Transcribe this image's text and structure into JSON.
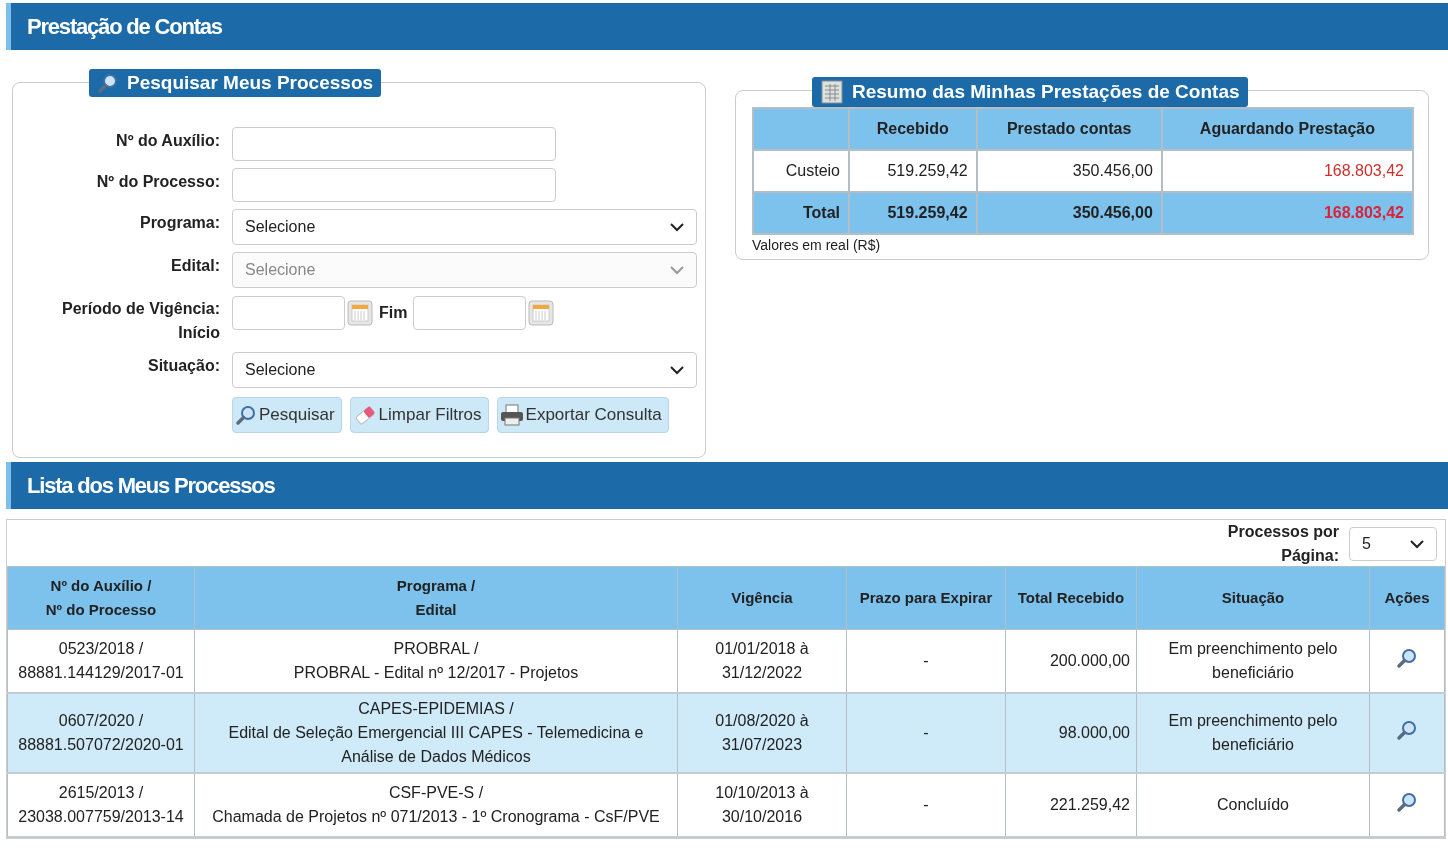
{
  "header": {
    "title": "Prestação de Contas"
  },
  "search": {
    "legend": "Pesquisar Meus Processos",
    "fields": [
      {
        "kind": "text",
        "label": "Nº do Auxílio:"
      },
      {
        "kind": "text",
        "label": "Nº do Processo:"
      },
      {
        "kind": "select",
        "label": "Programa:",
        "value": "Selecione",
        "disabled": false
      },
      {
        "kind": "select",
        "label": "Edital:",
        "value": "Selecione",
        "disabled": true
      },
      {
        "kind": "daterange",
        "label": "Período de Vigência:\nInício",
        "end_label": "Fim"
      },
      {
        "kind": "select",
        "label": "Situação:",
        "value": "Selecione",
        "disabled": false
      }
    ],
    "buttons": [
      {
        "kind": "search",
        "label": "Pesquisar"
      },
      {
        "kind": "eraser",
        "label": "Limpar Filtros"
      },
      {
        "kind": "printer",
        "label": "Exportar Consulta"
      }
    ]
  },
  "summary": {
    "legend": "Resumo das Minhas Prestações de Contas",
    "columns": [
      "Recebido",
      "Prestado contas",
      "Aguardando Prestação"
    ],
    "rows": [
      {
        "kind": "data",
        "label": "Custeio",
        "values": [
          "519.259,42",
          "350.456,00",
          "168.803,42"
        ]
      },
      {
        "kind": "total",
        "label": "Total",
        "values": [
          "519.259,42",
          "350.456,00",
          "168.803,42"
        ]
      }
    ],
    "note": "Valores em real (R$)"
  },
  "list": {
    "title": "Lista dos Meus Processos",
    "per_page_label": "Processos por\nPágina:",
    "per_page": "5",
    "columns": [
      "Nº do Auxílio /\nNº do Processo",
      "Programa /\nEdital",
      "Vigência",
      "Prazo para Expirar",
      "Total Recebido",
      "Situação",
      "Ações"
    ],
    "rows": [
      {
        "highlighted": false,
        "cells": [
          "0523/2018 /\n88881.144129/2017-01",
          "PROBRAL /\nPROBRAL - Edital nº 12/2017 - Projetos",
          "01/01/2018 à\n31/12/2022",
          "-",
          "200.000,00",
          "Em preenchimento pelo beneficiário"
        ]
      },
      {
        "highlighted": true,
        "cells": [
          "0607/2020 /\n88881.507072/2020-01",
          "CAPES-EPIDEMIAS /\nEdital de Seleção Emergencial III CAPES - Telemedicina e Análise de Dados Médicos",
          "01/08/2020 à\n31/07/2023",
          "-",
          "98.000,00",
          "Em preenchimento pelo beneficiário"
        ]
      },
      {
        "highlighted": false,
        "cells": [
          "2615/2013 /\n23038.007759/2013-14",
          "CSF-PVE-S /\nChamada de Projetos nº 071/2013 - 1º Cronograma - CsF/PVE",
          "10/10/2013 à\n30/10/2016",
          "-",
          "221.259,42",
          "Concluído"
        ]
      }
    ]
  }
}
